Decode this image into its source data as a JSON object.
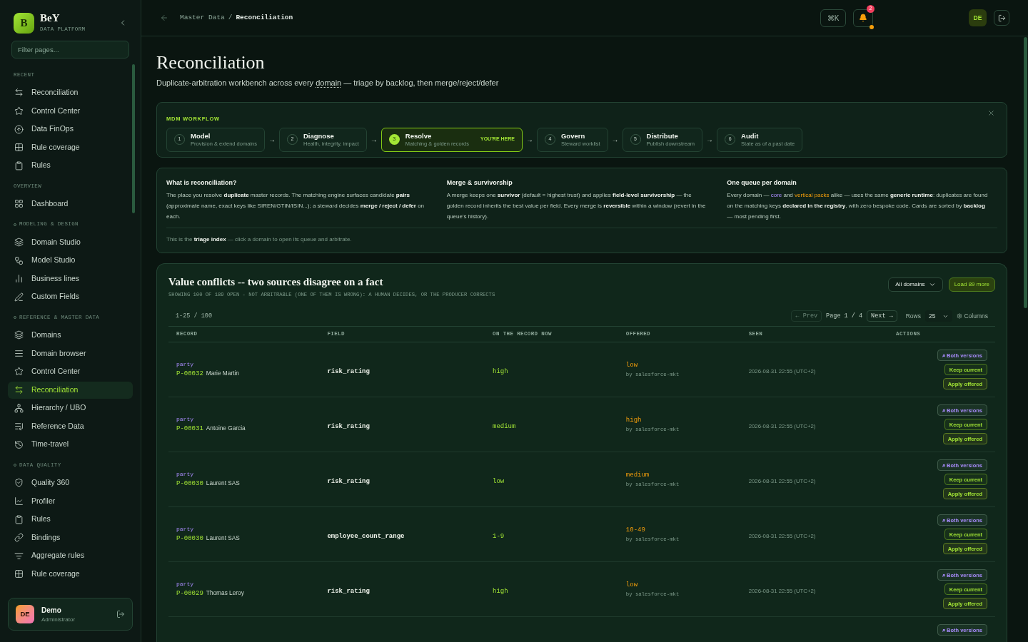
{
  "brand": {
    "logo_letter": "B",
    "name": "BeY",
    "tagline": "DATA PLATFORM"
  },
  "filter": {
    "placeholder": "Filter pages..."
  },
  "sidebar": {
    "sections": [
      {
        "title": "RECENT",
        "collapsible": false,
        "items": [
          {
            "label": "Reconciliation",
            "selected": false
          },
          {
            "label": "Control Center",
            "selected": false
          },
          {
            "label": "Data FinOps",
            "selected": false
          },
          {
            "label": "Rule coverage",
            "selected": false
          },
          {
            "label": "Rules",
            "selected": false
          }
        ]
      },
      {
        "title": "OVERVIEW",
        "collapsible": false,
        "items": [
          {
            "label": "Dashboard",
            "selected": false
          }
        ]
      },
      {
        "title": "MODELING & DESIGN",
        "collapsible": true,
        "items": [
          {
            "label": "Domain Studio",
            "selected": false
          },
          {
            "label": "Model Studio",
            "selected": false
          },
          {
            "label": "Business lines",
            "selected": false
          },
          {
            "label": "Custom Fields",
            "selected": false
          }
        ]
      },
      {
        "title": "REFERENCE & MASTER DATA",
        "collapsible": true,
        "items": [
          {
            "label": "Domains",
            "selected": false
          },
          {
            "label": "Domain browser",
            "selected": false
          },
          {
            "label": "Control Center",
            "selected": false
          },
          {
            "label": "Reconciliation",
            "selected": true
          },
          {
            "label": "Hierarchy / UBO",
            "selected": false
          },
          {
            "label": "Reference Data",
            "selected": false
          },
          {
            "label": "Time-travel",
            "selected": false
          }
        ]
      },
      {
        "title": "DATA QUALITY",
        "collapsible": true,
        "items": [
          {
            "label": "Quality 360",
            "selected": false
          },
          {
            "label": "Profiler",
            "selected": false
          },
          {
            "label": "Rules",
            "selected": false
          },
          {
            "label": "Bindings",
            "selected": false
          },
          {
            "label": "Aggregate rules",
            "selected": false
          },
          {
            "label": "Rule coverage",
            "selected": false
          }
        ]
      }
    ]
  },
  "user": {
    "initials": "DE",
    "name": "Demo",
    "role": "Administrator"
  },
  "topbar": {
    "breadcrumb": [
      "Master Data",
      "Reconciliation"
    ],
    "separator": "/",
    "shortcut": "⌘K",
    "notifications": "2",
    "avatar": "DE"
  },
  "page": {
    "title": "Reconciliation",
    "subtitle": [
      {
        "text": "Duplicate-arbitration workbench across every ",
        "kind": "plain"
      },
      {
        "text": "domain",
        "kind": "term"
      },
      {
        "text": " — triage by backlog, then merge/reject/defer",
        "kind": "plain"
      }
    ]
  },
  "workflow": {
    "title": "MDM WORKFLOW",
    "arrow": "→",
    "steps": [
      {
        "number": "1",
        "title": "Model",
        "subtitle": "Provision & extend domains",
        "selected": false
      },
      {
        "number": "2",
        "title": "Diagnose",
        "subtitle": "Health, integrity, impact",
        "selected": false
      },
      {
        "number": "3",
        "title": "Resolve",
        "subtitle": "Matching & golden records",
        "selected": true,
        "badge": "YOU'RE HERE"
      },
      {
        "number": "4",
        "title": "Govern",
        "subtitle": "Steward worklist",
        "selected": false
      },
      {
        "number": "5",
        "title": "Distribute",
        "subtitle": "Publish downstream",
        "selected": false
      },
      {
        "number": "6",
        "title": "Audit",
        "subtitle": "State as of a past date",
        "selected": false
      }
    ]
  },
  "info": {
    "columns": [
      {
        "title": "What is reconciliation?",
        "body": [
          {
            "text": "The place you resolve ",
            "kind": "plain"
          },
          {
            "text": "duplicate",
            "kind": "bold"
          },
          {
            "text": " master records. The matching engine surfaces candidate ",
            "kind": "plain"
          },
          {
            "text": "pairs",
            "kind": "bold"
          },
          {
            "text": " (approximate name, exact keys like SIREN/GTIN/ISIN...); a steward decides ",
            "kind": "plain"
          },
          {
            "text": "merge / reject / defer",
            "kind": "bold"
          },
          {
            "text": " on each.",
            "kind": "plain"
          }
        ]
      },
      {
        "title": "Merge & survivorship",
        "body": [
          {
            "text": "A merge keeps one ",
            "kind": "plain"
          },
          {
            "text": "survivor",
            "kind": "bold"
          },
          {
            "text": " (default = highest trust) and applies ",
            "kind": "plain"
          },
          {
            "text": "field-level survivorship",
            "kind": "bold"
          },
          {
            "text": " — the golden record inherits the best value per field. Every merge is ",
            "kind": "plain"
          },
          {
            "text": "reversible",
            "kind": "bold"
          },
          {
            "text": " within a window (revert in the queue's history).",
            "kind": "plain"
          }
        ]
      },
      {
        "title": "One queue per domain",
        "body": [
          {
            "text": "Every domain — ",
            "kind": "plain"
          },
          {
            "text": "core",
            "kind": "core"
          },
          {
            "text": " and ",
            "kind": "plain"
          },
          {
            "text": "vertical packs",
            "kind": "pack"
          },
          {
            "text": " alike — uses the same ",
            "kind": "plain"
          },
          {
            "text": "generic runtime",
            "kind": "bold"
          },
          {
            "text": ": duplicates are found on the matching keys ",
            "kind": "plain"
          },
          {
            "text": "declared in the registry",
            "kind": "bold"
          },
          {
            "text": ", with zero bespoke code. Cards are sorted by ",
            "kind": "plain"
          },
          {
            "text": "backlog",
            "kind": "bold"
          },
          {
            "text": " — most pending first.",
            "kind": "plain"
          }
        ]
      }
    ],
    "footer": [
      {
        "text": "This is the ",
        "kind": "plain"
      },
      {
        "text": "triage index",
        "kind": "bold"
      },
      {
        "text": " — click a domain to open its queue and arbitrate.",
        "kind": "plain"
      }
    ]
  },
  "conflicts": {
    "title": "Value conflicts -- two sources disagree on a fact",
    "subtitle": "SHOWING 100 OF 189 OPEN - NOT ARBITRABLE (ONE OF THEM IS WRONG): A HUMAN DECIDES, OR THE PRODUCER CORRECTS",
    "domain_select": "All domains",
    "load_more": "Load 89 more",
    "range": "1-25 / 100",
    "prev": {
      "label": "← Prev",
      "disabled": true
    },
    "page": "Page 1 / 4",
    "next": {
      "label": "Next →",
      "disabled": false
    },
    "rows_label": "Rows",
    "rows_value": "25",
    "columns_button": "Columns",
    "table": {
      "columns": [
        "RECORD",
        "FIELD",
        "ON THE RECORD NOW",
        "OFFERED",
        "SEEN",
        "ACTIONS"
      ],
      "rows": [
        {
          "entity": "party",
          "id": "P-00032",
          "name": "Marie Martin",
          "field": "risk_rating",
          "current": "high",
          "offered": "low",
          "source": "by salesforce-mkt",
          "seen": "2026-08-31 22:55 (UTC+2)",
          "actions": [
            {
              "label": "⌕ Both versions",
              "kind": "compare"
            },
            {
              "label": "Keep current",
              "kind": "keep"
            },
            {
              "label": "Apply offered",
              "kind": "apply"
            }
          ]
        },
        {
          "entity": "party",
          "id": "P-00031",
          "name": "Antoine Garcia",
          "field": "risk_rating",
          "current": "medium",
          "offered": "high",
          "source": "by salesforce-mkt",
          "seen": "2026-08-31 22:55 (UTC+2)",
          "actions": [
            {
              "label": "⌕ Both versions",
              "kind": "compare"
            },
            {
              "label": "Keep current",
              "kind": "keep"
            },
            {
              "label": "Apply offered",
              "kind": "apply"
            }
          ]
        },
        {
          "entity": "party",
          "id": "P-00030",
          "name": "Laurent SAS",
          "field": "risk_rating",
          "current": "low",
          "offered": "medium",
          "source": "by salesforce-mkt",
          "seen": "2026-08-31 22:55 (UTC+2)",
          "actions": [
            {
              "label": "⌕ Both versions",
              "kind": "compare"
            },
            {
              "label": "Keep current",
              "kind": "keep"
            },
            {
              "label": "Apply offered",
              "kind": "apply"
            }
          ]
        },
        {
          "entity": "party",
          "id": "P-00030",
          "name": "Laurent SAS",
          "field": "employee_count_range",
          "current": "1-9",
          "offered": "10-49",
          "source": "by salesforce-mkt",
          "seen": "2026-08-31 22:55 (UTC+2)",
          "actions": [
            {
              "label": "⌕ Both versions",
              "kind": "compare"
            },
            {
              "label": "Keep current",
              "kind": "keep"
            },
            {
              "label": "Apply offered",
              "kind": "apply"
            }
          ]
        },
        {
          "entity": "party",
          "id": "P-00029",
          "name": "Thomas Leroy",
          "field": "risk_rating",
          "current": "high",
          "offered": "low",
          "source": "by salesforce-mkt",
          "seen": "2026-08-31 22:55 (UTC+2)",
          "actions": [
            {
              "label": "⌕ Both versions",
              "kind": "compare"
            },
            {
              "label": "Keep current",
              "kind": "keep"
            },
            {
              "label": "Apply offered",
              "kind": "apply"
            }
          ]
        },
        {
          "actions": [
            {
              "label": "⌕ Both versions",
              "kind": "compare"
            }
          ]
        }
      ]
    }
  }
}
